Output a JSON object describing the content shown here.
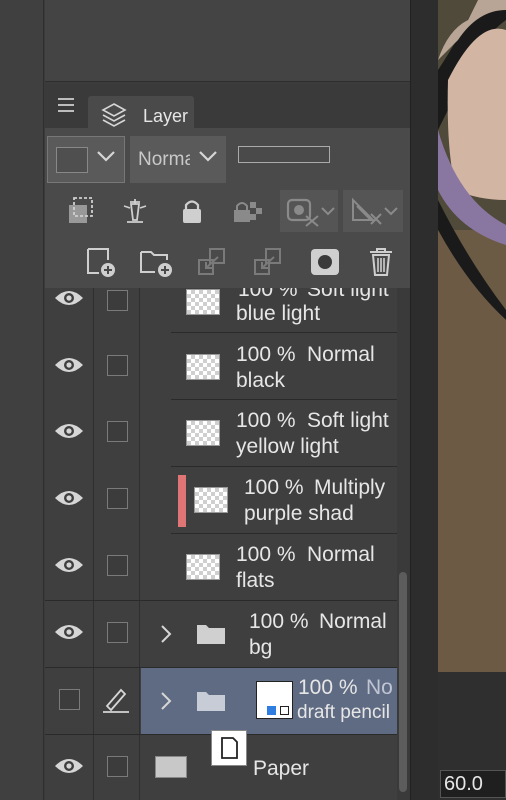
{
  "panel": {
    "tab_label": "Layer",
    "blend_mode": "Normal",
    "zoom": "60.0"
  },
  "colors": {
    "selected_row": "#5f6b83",
    "purple_marker": "#e07575"
  },
  "layers": [
    {
      "opacity": "100 %",
      "mode": "Soft light",
      "name": "blue light"
    },
    {
      "opacity": "100 %",
      "mode": "Normal",
      "name": "black"
    },
    {
      "opacity": "100 %",
      "mode": "Soft light",
      "name": "yellow light"
    },
    {
      "opacity": "100 %",
      "mode": "Multiply",
      "name": "purple shad"
    },
    {
      "opacity": "100 %",
      "mode": "Normal",
      "name": "flats"
    },
    {
      "opacity": "100 %",
      "mode": "Normal",
      "name": "bg"
    },
    {
      "opacity": "100 %",
      "mode": "No",
      "name": "draft pencil"
    },
    {
      "opacity": "",
      "mode": "",
      "name": "Paper"
    }
  ]
}
